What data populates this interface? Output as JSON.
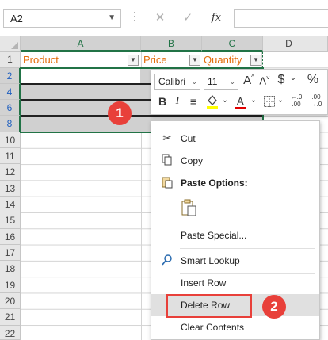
{
  "formula_bar": {
    "name_box": "A2",
    "cancel_symbol": "✕",
    "enter_symbol": "✓",
    "fx_symbol": "fx",
    "formula_value": ""
  },
  "columns": [
    "A",
    "B",
    "C",
    "D"
  ],
  "rows": [
    "1",
    "2",
    "4",
    "6",
    "8",
    "10",
    "11",
    "12",
    "13",
    "14",
    "15",
    "16",
    "17",
    "18",
    "19",
    "20",
    "21",
    "22"
  ],
  "table": {
    "headers": [
      "Product",
      "Price",
      "Quantity"
    ]
  },
  "mini_toolbar": {
    "font_name": "Calibri",
    "font_size": "11",
    "grow_font": "A^",
    "shrink_font": "A˅",
    "currency": "$",
    "percent": "%",
    "bold": "B",
    "italic": "I",
    "align": "≡",
    "comma": ",",
    "inc_decimal": "←.0 .00",
    "dec_decimal": ".00 →.0"
  },
  "context_menu": {
    "items": [
      {
        "label": "Cut",
        "icon": "scissors-icon"
      },
      {
        "label": "Copy",
        "icon": "copy-icon"
      },
      {
        "label": "Paste Options:",
        "icon": "paste-icon"
      },
      {
        "label": "Paste Special...",
        "icon": ""
      },
      {
        "label": "Smart Lookup",
        "icon": "search-icon"
      },
      {
        "label": "Insert Row",
        "icon": ""
      },
      {
        "label": "Delete Row",
        "icon": ""
      },
      {
        "label": "Clear Contents",
        "icon": ""
      }
    ]
  },
  "callouts": {
    "first": "1",
    "second": "2"
  },
  "colors": {
    "accent_green": "#217346",
    "header_text_orange": "#e36c0a",
    "callout_red": "#e8403a",
    "row_number_blue": "#1f5fbf"
  }
}
